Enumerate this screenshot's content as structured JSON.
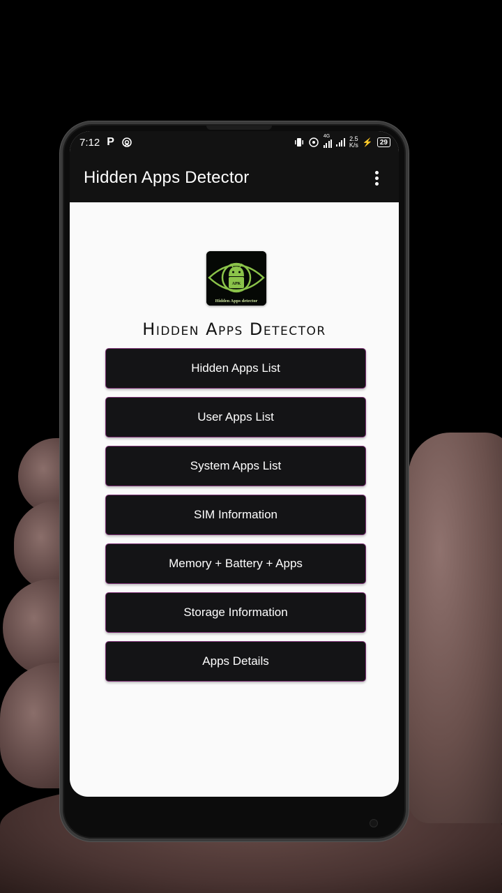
{
  "status_bar": {
    "time": "7:12",
    "left_icons": [
      "p-app-icon",
      "hotspot-icon"
    ],
    "right_icons": [
      "vibrate-icon",
      "wifi-hotspot-icon",
      "signal-4g-icon",
      "signal-icon",
      "charging-icon"
    ],
    "network_type": "4G",
    "net_speed_value": "2.5",
    "net_speed_unit": "K/s",
    "battery_level": "29"
  },
  "app_bar": {
    "title": "Hidden Apps Detector",
    "menu_icon": "overflow-menu-icon"
  },
  "main": {
    "logo_caption": "Hidden Apps detector",
    "logo_badge": "APK",
    "headline": "Hidden Apps Detector",
    "buttons": [
      {
        "label": "Hidden Apps List"
      },
      {
        "label": "User Apps List"
      },
      {
        "label": "System Apps List"
      },
      {
        "label": "SIM Information"
      },
      {
        "label": "Memory + Battery + Apps"
      },
      {
        "label": "Storage Information"
      },
      {
        "label": "Apps Details"
      }
    ]
  },
  "colors": {
    "app_bar_bg": "#121212",
    "button_bg": "#141416",
    "button_border": "#7a2e72",
    "screen_bg": "#fafafa",
    "logo_green": "#8bc34a"
  }
}
